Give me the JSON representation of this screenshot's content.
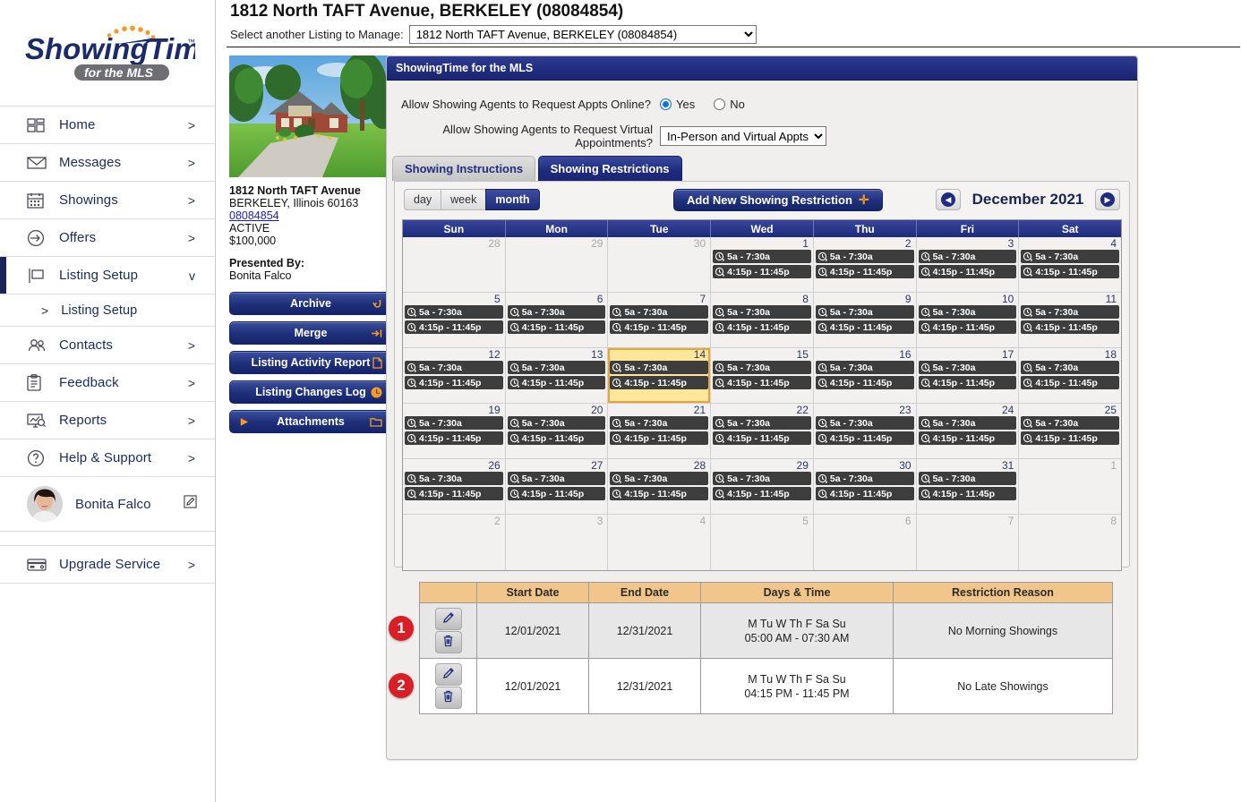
{
  "brand": {
    "logo_main": "ShowingTime",
    "logo_sub": "for the MLS",
    "accent_orange": "#f59a23",
    "navy": "#1e2b7c",
    "badge_red": "#d81f26"
  },
  "sidebar": {
    "items": [
      {
        "label": "Home",
        "icon": "dashboard-icon",
        "chevron": ">",
        "active": false
      },
      {
        "label": "Messages",
        "icon": "envelope-icon",
        "chevron": ">",
        "active": false
      },
      {
        "label": "Showings",
        "icon": "calendar-icon",
        "chevron": ">",
        "active": false
      },
      {
        "label": "Offers",
        "icon": "offers-arrow-icon",
        "chevron": ">",
        "active": false
      },
      {
        "label": "Listing Setup",
        "icon": "sign-post-icon",
        "chevron": "v",
        "active": true
      },
      {
        "label": "Listing Setup",
        "icon": "sub-arrow-icon",
        "chevron": "",
        "sub": true
      },
      {
        "label": "Contacts",
        "icon": "people-icon",
        "chevron": ">",
        "active": false
      },
      {
        "label": "Feedback",
        "icon": "clipboard-icon",
        "chevron": ">",
        "active": false
      },
      {
        "label": "Reports",
        "icon": "reports-icon",
        "chevron": ">",
        "active": false
      },
      {
        "label": "Help & Support",
        "icon": "question-circle-icon",
        "chevron": ">",
        "active": false
      }
    ],
    "user": {
      "name": "Bonita Falco",
      "edit_icon": "pencil-icon"
    },
    "upgrade": {
      "label": "Upgrade Service",
      "icon": "credit-card-icon",
      "chevron": ">"
    }
  },
  "header": {
    "page_title": "1812 North TAFT Avenue, BERKELEY (08084854)",
    "select_label": "Select another Listing to Manage:",
    "selected_listing": "1812 North TAFT Avenue, BERKELEY (08084854)"
  },
  "property": {
    "photo_alt": "house-photo",
    "address_line1": "1812 North TAFT Avenue",
    "address_line2": "BERKELEY, Illinois 60163",
    "mls_number": "08084854",
    "status": "ACTIVE",
    "price": "$100,000",
    "presented_by_label": "Presented By:",
    "presented_by_name": "Bonita Falco",
    "buttons": [
      {
        "label": "Archive",
        "icon": "archive-arrow-icon"
      },
      {
        "label": "Merge",
        "icon": "merge-icon"
      },
      {
        "label": "Listing Activity Report",
        "icon": "document-icon"
      },
      {
        "label": "Listing Changes Log",
        "icon": "clock-icon"
      },
      {
        "label": "Attachments",
        "icon": "folder-icon",
        "left_icon": "triangle-right-icon"
      }
    ]
  },
  "panel": {
    "title": "ShowingTime for the MLS",
    "question1": "Allow Showing Agents to Request Appts Online?",
    "radio_yes": "Yes",
    "radio_no": "No",
    "radio_selected": "Yes",
    "question2": "Allow Showing Agents to Request Virtual Appointments?",
    "virtual_value": "In-Person and Virtual Appts",
    "tabs": [
      {
        "label": "Showing Instructions",
        "active": false
      },
      {
        "label": "Showing Restrictions",
        "active": true
      }
    ]
  },
  "calendar": {
    "views": [
      {
        "label": "day",
        "active": false
      },
      {
        "label": "week",
        "active": false
      },
      {
        "label": "month",
        "active": true
      }
    ],
    "add_button": "Add New Showing Restriction",
    "add_icon": "plus-icon",
    "prev_icon": "chevron-left-icon",
    "next_icon": "chevron-right-icon",
    "month_label": "December 2021",
    "day_names": [
      "Sun",
      "Mon",
      "Tue",
      "Wed",
      "Thu",
      "Fri",
      "Sat"
    ],
    "event_icon": "recurring-clock-icon",
    "event_a": "5a - 7:30a",
    "event_b": "4:15p - 11:45p",
    "weeks": [
      [
        {
          "num": "28",
          "other": true,
          "today": false,
          "events": []
        },
        {
          "num": "29",
          "other": true,
          "today": false,
          "events": []
        },
        {
          "num": "30",
          "other": true,
          "today": false,
          "events": []
        },
        {
          "num": "1",
          "other": false,
          "today": false,
          "events": [
            "5a - 7:30a",
            "4:15p - 11:45p"
          ]
        },
        {
          "num": "2",
          "other": false,
          "today": false,
          "events": [
            "5a - 7:30a",
            "4:15p - 11:45p"
          ]
        },
        {
          "num": "3",
          "other": false,
          "today": false,
          "events": [
            "5a - 7:30a",
            "4:15p - 11:45p"
          ]
        },
        {
          "num": "4",
          "other": false,
          "today": false,
          "events": [
            "5a - 7:30a",
            "4:15p - 11:45p"
          ]
        }
      ],
      [
        {
          "num": "5",
          "other": false,
          "today": false,
          "events": [
            "5a - 7:30a",
            "4:15p - 11:45p"
          ]
        },
        {
          "num": "6",
          "other": false,
          "today": false,
          "events": [
            "5a - 7:30a",
            "4:15p - 11:45p"
          ]
        },
        {
          "num": "7",
          "other": false,
          "today": false,
          "events": [
            "5a - 7:30a",
            "4:15p - 11:45p"
          ]
        },
        {
          "num": "8",
          "other": false,
          "today": false,
          "events": [
            "5a - 7:30a",
            "4:15p - 11:45p"
          ]
        },
        {
          "num": "9",
          "other": false,
          "today": false,
          "events": [
            "5a - 7:30a",
            "4:15p - 11:45p"
          ]
        },
        {
          "num": "10",
          "other": false,
          "today": false,
          "events": [
            "5a - 7:30a",
            "4:15p - 11:45p"
          ]
        },
        {
          "num": "11",
          "other": false,
          "today": false,
          "events": [
            "5a - 7:30a",
            "4:15p - 11:45p"
          ]
        }
      ],
      [
        {
          "num": "12",
          "other": false,
          "today": false,
          "events": [
            "5a - 7:30a",
            "4:15p - 11:45p"
          ]
        },
        {
          "num": "13",
          "other": false,
          "today": false,
          "events": [
            "5a - 7:30a",
            "4:15p - 11:45p"
          ]
        },
        {
          "num": "14",
          "other": false,
          "today": true,
          "events": [
            "5a - 7:30a",
            "4:15p - 11:45p"
          ]
        },
        {
          "num": "15",
          "other": false,
          "today": false,
          "events": [
            "5a - 7:30a",
            "4:15p - 11:45p"
          ]
        },
        {
          "num": "16",
          "other": false,
          "today": false,
          "events": [
            "5a - 7:30a",
            "4:15p - 11:45p"
          ]
        },
        {
          "num": "17",
          "other": false,
          "today": false,
          "events": [
            "5a - 7:30a",
            "4:15p - 11:45p"
          ]
        },
        {
          "num": "18",
          "other": false,
          "today": false,
          "events": [
            "5a - 7:30a",
            "4:15p - 11:45p"
          ]
        }
      ],
      [
        {
          "num": "19",
          "other": false,
          "today": false,
          "events": [
            "5a - 7:30a",
            "4:15p - 11:45p"
          ]
        },
        {
          "num": "20",
          "other": false,
          "today": false,
          "events": [
            "5a - 7:30a",
            "4:15p - 11:45p"
          ]
        },
        {
          "num": "21",
          "other": false,
          "today": false,
          "events": [
            "5a - 7:30a",
            "4:15p - 11:45p"
          ]
        },
        {
          "num": "22",
          "other": false,
          "today": false,
          "events": [
            "5a - 7:30a",
            "4:15p - 11:45p"
          ]
        },
        {
          "num": "23",
          "other": false,
          "today": false,
          "events": [
            "5a - 7:30a",
            "4:15p - 11:45p"
          ]
        },
        {
          "num": "24",
          "other": false,
          "today": false,
          "events": [
            "5a - 7:30a",
            "4:15p - 11:45p"
          ]
        },
        {
          "num": "25",
          "other": false,
          "today": false,
          "events": [
            "5a - 7:30a",
            "4:15p - 11:45p"
          ]
        }
      ],
      [
        {
          "num": "26",
          "other": false,
          "today": false,
          "events": [
            "5a - 7:30a",
            "4:15p - 11:45p"
          ]
        },
        {
          "num": "27",
          "other": false,
          "today": false,
          "events": [
            "5a - 7:30a",
            "4:15p - 11:45p"
          ]
        },
        {
          "num": "28",
          "other": false,
          "today": false,
          "events": [
            "5a - 7:30a",
            "4:15p - 11:45p"
          ]
        },
        {
          "num": "29",
          "other": false,
          "today": false,
          "events": [
            "5a - 7:30a",
            "4:15p - 11:45p"
          ]
        },
        {
          "num": "30",
          "other": false,
          "today": false,
          "events": [
            "5a - 7:30a",
            "4:15p - 11:45p"
          ]
        },
        {
          "num": "31",
          "other": false,
          "today": false,
          "events": [
            "5a - 7:30a",
            "4:15p - 11:45p"
          ]
        },
        {
          "num": "1",
          "other": true,
          "today": false,
          "events": []
        }
      ],
      [
        {
          "num": "2",
          "other": true,
          "today": false,
          "events": []
        },
        {
          "num": "3",
          "other": true,
          "today": false,
          "events": []
        },
        {
          "num": "4",
          "other": true,
          "today": false,
          "events": []
        },
        {
          "num": "5",
          "other": true,
          "today": false,
          "events": []
        },
        {
          "num": "6",
          "other": true,
          "today": false,
          "events": []
        },
        {
          "num": "7",
          "other": true,
          "today": false,
          "events": []
        },
        {
          "num": "8",
          "other": true,
          "today": false,
          "events": []
        }
      ]
    ]
  },
  "restrictions_table": {
    "columns": [
      "",
      "Start Date",
      "End Date",
      "Days & Time",
      "Restriction Reason"
    ],
    "edit_icon": "pencil-icon",
    "delete_icon": "trash-icon",
    "rows": [
      {
        "badge": "1",
        "start_date": "12/01/2021",
        "end_date": "12/31/2021",
        "days": "M Tu W Th F Sa Su",
        "time": "05:00 AM - 07:30 AM",
        "reason": "No Morning Showings"
      },
      {
        "badge": "2",
        "start_date": "12/01/2021",
        "end_date": "12/31/2021",
        "days": "M Tu W Th F Sa Su",
        "time": "04:15 PM - 11:45 PM",
        "reason": "No Late Showings"
      }
    ]
  }
}
